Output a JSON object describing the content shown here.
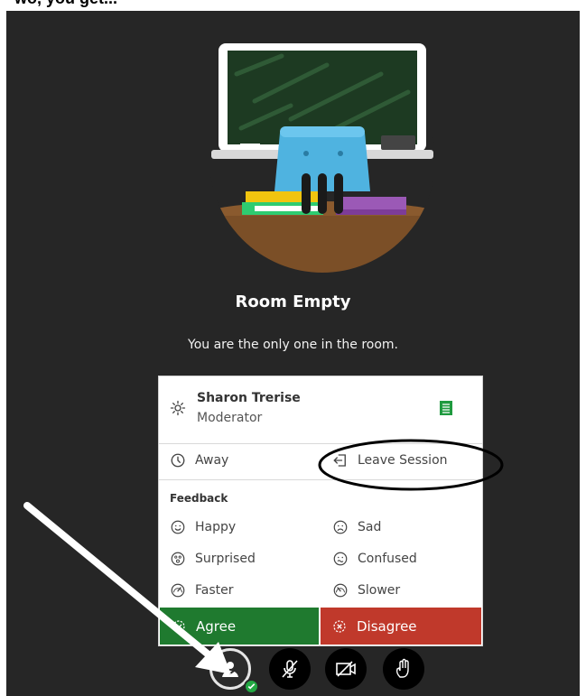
{
  "page_top_text": "wo, you get...",
  "room": {
    "title": "Room Empty",
    "subtitle": "You are the only one in the room."
  },
  "profile": {
    "name": "Sharon Trerise",
    "role": "Moderator"
  },
  "status": {
    "away_label": "Away",
    "leave_label": "Leave Session"
  },
  "feedback": {
    "heading": "Feedback",
    "options": [
      {
        "label": "Happy",
        "icon": "happy-face-icon"
      },
      {
        "label": "Sad",
        "icon": "sad-face-icon"
      },
      {
        "label": "Surprised",
        "icon": "surprised-face-icon"
      },
      {
        "label": "Confused",
        "icon": "confused-face-icon"
      },
      {
        "label": "Faster",
        "icon": "faster-icon"
      },
      {
        "label": "Slower",
        "icon": "slower-icon"
      }
    ],
    "agree_label": "Agree",
    "disagree_label": "Disagree"
  },
  "colors": {
    "stage_bg": "#262626",
    "agree": "#1f7a2f",
    "disagree": "#c0392b",
    "status_ok": "#22a843"
  }
}
